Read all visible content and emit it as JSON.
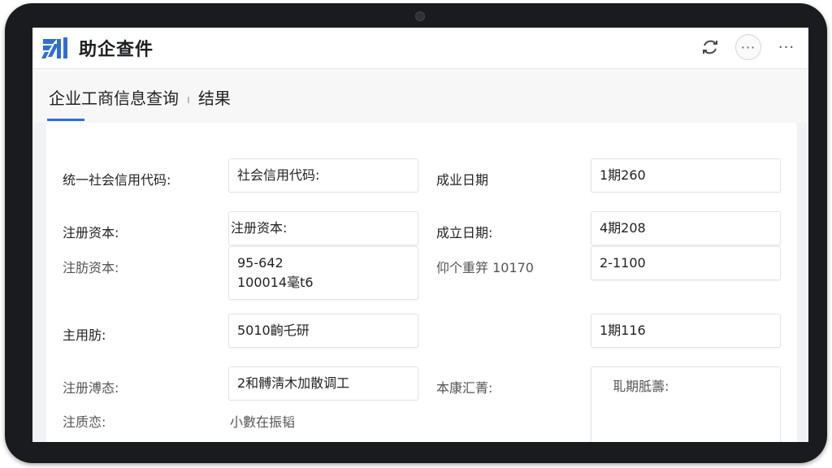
{
  "app": {
    "title": "助企查件",
    "brand_color": "#2f6fd0",
    "actions": [
      {
        "name": "refresh-icon",
        "glyph": "⟳"
      },
      {
        "name": "more-circle-icon",
        "glyph": "···"
      },
      {
        "name": "more-icon",
        "glyph": "···"
      }
    ]
  },
  "breadcrumb": {
    "section": "企业工商信息查询",
    "current": "结果"
  },
  "form": {
    "credit_code_label": "统一社会信用代码:",
    "credit_code_value": "社会信用代码:",
    "established_label_1": "成业日期",
    "established_value_1": "1期260",
    "capital_label": "注册资本:",
    "capital_value": "注册资本:",
    "established_label_2": "成立日期:",
    "established_value_2": "4期208",
    "capital_label_2": "注肪资本:",
    "capital_value_2_line1": "95-642",
    "capital_value_2_line2": "100014毫t6",
    "registration_label": "仰个重笄 10170",
    "registration_value": "2-1100",
    "main_label": "主用肪:",
    "main_value": "5010齣乇研",
    "date_value_3": "1期116",
    "status_label": "注册溥态:",
    "status_value": "2和髆淸木加散调工",
    "scope_label": "本康汇菁:",
    "scope_value": "耴期胝薵:",
    "state_label": "注质恋:",
    "state_value": "小數在振韬"
  }
}
